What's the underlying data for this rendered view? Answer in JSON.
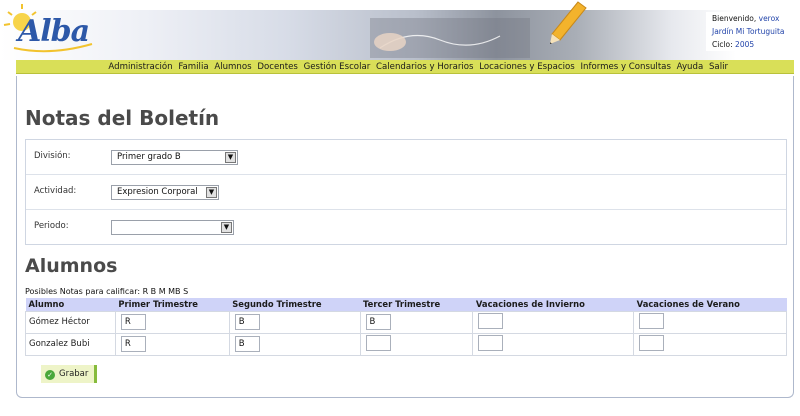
{
  "header": {
    "logo_text": "Alba",
    "user": {
      "welcome_label": "Bienvenido,",
      "username": "verox",
      "school": "Jardín Mi Tortuguita",
      "cycle_label": "Ciclo:",
      "cycle_value": "2005"
    }
  },
  "nav": {
    "items": [
      "Administración",
      "Familia",
      "Alumnos",
      "Docentes",
      "Gestión Escolar",
      "Calendarios y Horarios",
      "Locaciones y Espacios",
      "Informes y Consultas",
      "Ayuda",
      "Salir"
    ]
  },
  "page": {
    "title": "Notas del Boletín",
    "filters": {
      "division_label": "División:",
      "division_value": "Primer grado B",
      "activity_label": "Actividad:",
      "activity_value": "Expresion Corporal",
      "period_label": "Periodo:",
      "period_value": ""
    },
    "students_title": "Alumnos",
    "possible_grades": "Posibles Notas para calificar: R B M MB S",
    "table": {
      "headers": [
        "Alumno",
        "Primer Trimestre",
        "Segundo Trimestre",
        "Tercer Trimestre",
        "Vacaciones de Invierno",
        "Vacaciones de Verano"
      ],
      "rows": [
        {
          "name": "Gómez Héctor",
          "grades": [
            "R",
            "B",
            "B",
            "",
            ""
          ]
        },
        {
          "name": "Gonzalez Bubi",
          "grades": [
            "R",
            "B",
            "",
            "",
            ""
          ]
        }
      ]
    },
    "save_label": "Grabar"
  },
  "colors": {
    "nav_bar": "#d9df58",
    "table_header": "#cfd3f8",
    "link": "#2244aa",
    "save_accent": "#86bb3c"
  }
}
